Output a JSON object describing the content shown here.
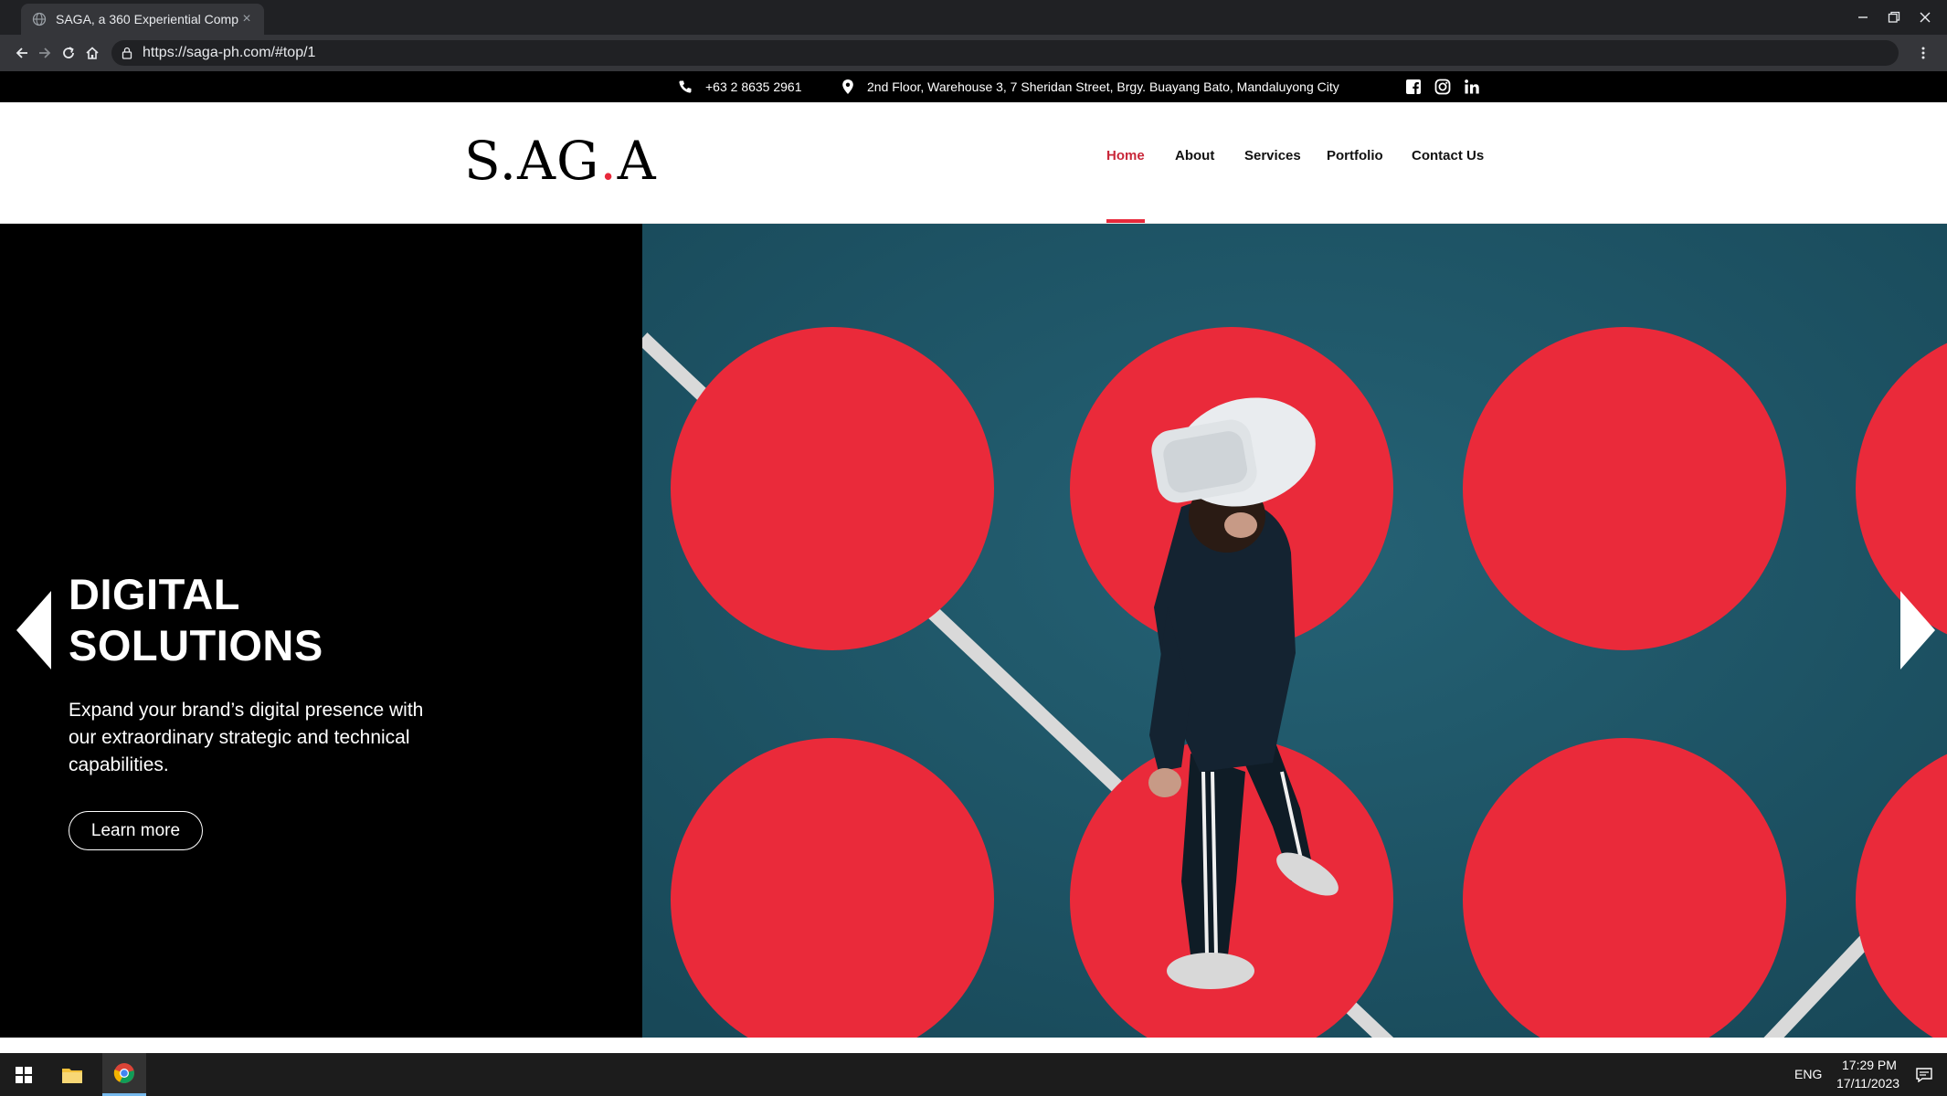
{
  "browser": {
    "tab_title": "SAGA, a 360 Experiential Comp",
    "url": "https://saga-ph.com/#top/1"
  },
  "topbar": {
    "phone": "+63 2 8635 2961",
    "address": "2nd Floor, Warehouse 3, 7 Sheridan Street, Brgy. Buayang Bato, Mandaluyong City"
  },
  "logo": {
    "text": "S.AG",
    "dot": ".",
    "last": "A"
  },
  "nav": {
    "items": [
      "Home",
      "About",
      "Services",
      "Portfolio",
      "Contact Us"
    ],
    "active": "Home"
  },
  "hero": {
    "title_line1": "DIGITAL",
    "title_line2": "SOLUTIONS",
    "subtitle": "Expand your brand’s digital presence with our extraordinary strategic and technical capabilities.",
    "button": "Learn more"
  },
  "taskbar": {
    "language": "ENG",
    "time": "17:29 PM",
    "date": "17/11/2023"
  },
  "colors": {
    "accent_red": "#e8293b",
    "teal": "#1f5567"
  }
}
